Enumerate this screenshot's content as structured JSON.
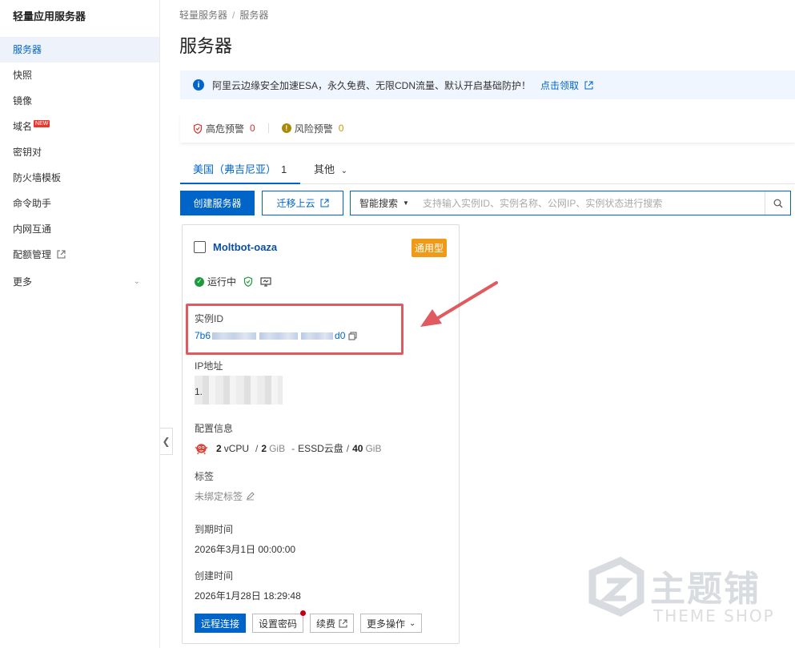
{
  "sidebar": {
    "title": "轻量应用服务器",
    "items": [
      {
        "label": "服务器",
        "active": true
      },
      {
        "label": "快照"
      },
      {
        "label": "镜像"
      },
      {
        "label": "域名",
        "badge": "NEW"
      },
      {
        "label": "密钥对"
      },
      {
        "label": "防火墙模板"
      },
      {
        "label": "命令助手"
      },
      {
        "label": "内网互通"
      },
      {
        "label": "配额管理",
        "external": true
      },
      {
        "label": "更多",
        "expandable": true
      }
    ]
  },
  "breadcrumb": [
    "轻量服务器",
    "服务器"
  ],
  "page_title": "服务器",
  "notice": {
    "text": "阿里云边缘安全加速ESA，永久免费、无限CDN流量、默认开启基础防护！",
    "link": "点击领取"
  },
  "alerts": {
    "high_label": "高危预警",
    "high_count": "0",
    "risk_label": "风险预警",
    "risk_count": "0"
  },
  "tabs": {
    "active_label": "美国（弗吉尼亚）",
    "active_count": "1",
    "other_label": "其他"
  },
  "toolbar": {
    "create_label": "创建服务器",
    "migrate_label": "迁移上云",
    "search_mode": "智能搜索",
    "search_placeholder": "支持输入实例ID、实例名称、公网IP、实例状态进行搜索"
  },
  "card": {
    "name": "Moltbot-oaza",
    "type_badge": "通用型",
    "status": "运行中",
    "instance_id_label": "实例ID",
    "instance_id_prefix": "7b6",
    "instance_id_suffix": "d0",
    "ip_label": "IP地址",
    "ip_prefix": "1.",
    "config_label": "配置信息",
    "config": {
      "vcpu": "2",
      "vcpu_unit": "vCPU",
      "mem": "2",
      "mem_unit": "GiB",
      "disk_type": "ESSD云盘",
      "disk": "40",
      "disk_unit": "GiB"
    },
    "tag_label": "标签",
    "tag_value": "未绑定标签",
    "expire_label": "到期时间",
    "expire_value": "2026年3月1日 00:00:00",
    "created_label": "创建时间",
    "created_value": "2026年1月28日 18:29:48",
    "actions": {
      "remote": "远程连接",
      "password": "设置密码",
      "renew": "续费",
      "more": "更多操作"
    }
  },
  "watermark": {
    "title": "主题铺",
    "subtitle": "THEME SHOP"
  },
  "colors": {
    "primary": "#0064c8",
    "badge_orange": "#f09a17",
    "highlight_red": "#e05a5f",
    "status_green": "#1e9a3c"
  }
}
